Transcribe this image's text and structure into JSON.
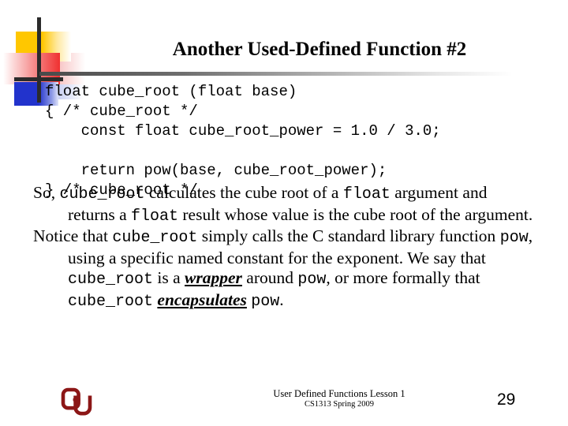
{
  "slide": {
    "title": "Another Used-Defined Function #2",
    "code_lines": [
      "float cube_root (float base)",
      "{ /* cube_root */",
      "    const float cube_root_power = 1.0 / 3.0;",
      "",
      "    return pow(base, cube_root_power);",
      "} /* cube_root */"
    ],
    "bullets": [
      {
        "parts": [
          {
            "text": "So, ",
            "style": "serif"
          },
          {
            "text": "cube_root",
            "style": "mono"
          },
          {
            "text": " calculates the cube root of a ",
            "style": "serif"
          },
          {
            "text": "float",
            "style": "mono"
          },
          {
            "text": " argument and returns a ",
            "style": "serif"
          },
          {
            "text": "float",
            "style": "mono"
          },
          {
            "text": " result whose value is the cube root of the argument.",
            "style": "serif"
          }
        ]
      },
      {
        "parts": [
          {
            "text": "Notice that ",
            "style": "serif"
          },
          {
            "text": "cube_root",
            "style": "mono"
          },
          {
            "text": " simply calls the C standard library function ",
            "style": "serif"
          },
          {
            "text": "pow",
            "style": "mono"
          },
          {
            "text": ", using a specific named  constant for the exponent. We say that ",
            "style": "serif"
          },
          {
            "text": "cube_root",
            "style": "mono"
          },
          {
            "text": " is a ",
            "style": "serif"
          },
          {
            "text": "wrapper",
            "style": "emph"
          },
          {
            "text": " around ",
            "style": "serif"
          },
          {
            "text": "pow",
            "style": "mono"
          },
          {
            "text": ", or more formally that ",
            "style": "serif"
          },
          {
            "text": "cube_root",
            "style": "mono"
          },
          {
            "text": " ",
            "style": "serif"
          },
          {
            "text": "encapsulates",
            "style": "emph"
          },
          {
            "text": " ",
            "style": "serif"
          },
          {
            "text": "pow",
            "style": "mono"
          },
          {
            "text": ".",
            "style": "serif"
          }
        ]
      }
    ],
    "footer": {
      "line1": "User Defined Functions Lesson 1",
      "line2": "CS1313 Spring 2009",
      "page_number": "29",
      "logo_name": "ou-logo"
    },
    "colors": {
      "logo_crimson": "#8C1616",
      "deco_yellow": "#FFC700",
      "deco_red": "#F03030",
      "deco_blue": "#2233CC",
      "rule_gray": "#4a4a4a"
    }
  }
}
